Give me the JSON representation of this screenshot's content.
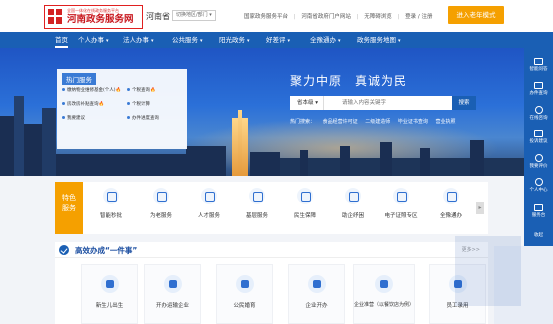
{
  "header": {
    "logo_sub": "全国一体化在线政务服务平台",
    "logo_main": "河南政务服务网",
    "province": "河南省",
    "region_select": "切换地区/部门 ▾",
    "top_links": [
      "国家政务服务平台",
      "|",
      "河南省政府门户网站",
      "|",
      "无障碍浏览",
      "|",
      "登录 / 注册"
    ],
    "elder_button": "进入老年模式"
  },
  "nav": {
    "items": [
      {
        "label": "首页",
        "caret": ""
      },
      {
        "label": "个人办事",
        "caret": "▾"
      },
      {
        "label": "法人办事",
        "caret": "▾"
      },
      {
        "label": "公共服务",
        "caret": "▾"
      },
      {
        "label": "阳光政务",
        "caret": "▾"
      },
      {
        "label": "好差评",
        "caret": "▾"
      },
      {
        "label": "全豫通办",
        "caret": "▾"
      },
      {
        "label": "政务服务地图",
        "caret": "▾"
      }
    ]
  },
  "banner": {
    "hot_title": "热门服务",
    "hot_items": [
      {
        "label": "缴纳物业维修基金(个人)",
        "fire": "🔥"
      },
      {
        "label": "个税查询",
        "fire": "🔥"
      },
      {
        "label": "房改房补贴查询",
        "fire": "🔥"
      },
      {
        "label": "个税计算",
        "fire": ""
      },
      {
        "label": "我要建议",
        "fire": ""
      },
      {
        "label": "办件进度查询",
        "fire": ""
      }
    ],
    "slogan": "聚力中原　真诚为民",
    "search_scope": "省本级 ▾",
    "search_placeholder": "请输入内容关键字",
    "search_button": "搜索",
    "hot_search_label": "热门搜索：",
    "hot_search_items": [
      "食品经营许可证",
      "二级建造师",
      "毕业证书查询",
      "营业执照"
    ]
  },
  "right_bar": {
    "items": [
      "智能问答",
      "办件查询",
      "在线咨询",
      "投诉建议",
      "我要评价",
      "个人中心",
      "服务台",
      "收起"
    ]
  },
  "services": {
    "feature_tab": "特色\n服务",
    "items": [
      "智能秒批",
      "为老服务",
      "人才服务",
      "基层服务",
      "民生保障",
      "助企纾困",
      "电子证照专区",
      "全豫通办"
    ],
    "arrow": "▸"
  },
  "onething": {
    "title": "高效办成“一件事”",
    "more": "更多>>",
    "cards": [
      {
        "label": "新生儿出生",
        "sub": ""
      },
      {
        "label": "开办运输企业",
        "sub": ""
      },
      {
        "label": "公民婚育",
        "sub": ""
      },
      {
        "label": "企业开办",
        "sub": ""
      },
      {
        "label": "企业准营（以餐饮店为例）",
        "sub": ""
      },
      {
        "label": "员工录用",
        "sub": ""
      }
    ]
  },
  "colors": {
    "brand_blue": "#1a5fb4",
    "accent_orange": "#f5a000",
    "logo_red": "#c8161d"
  }
}
